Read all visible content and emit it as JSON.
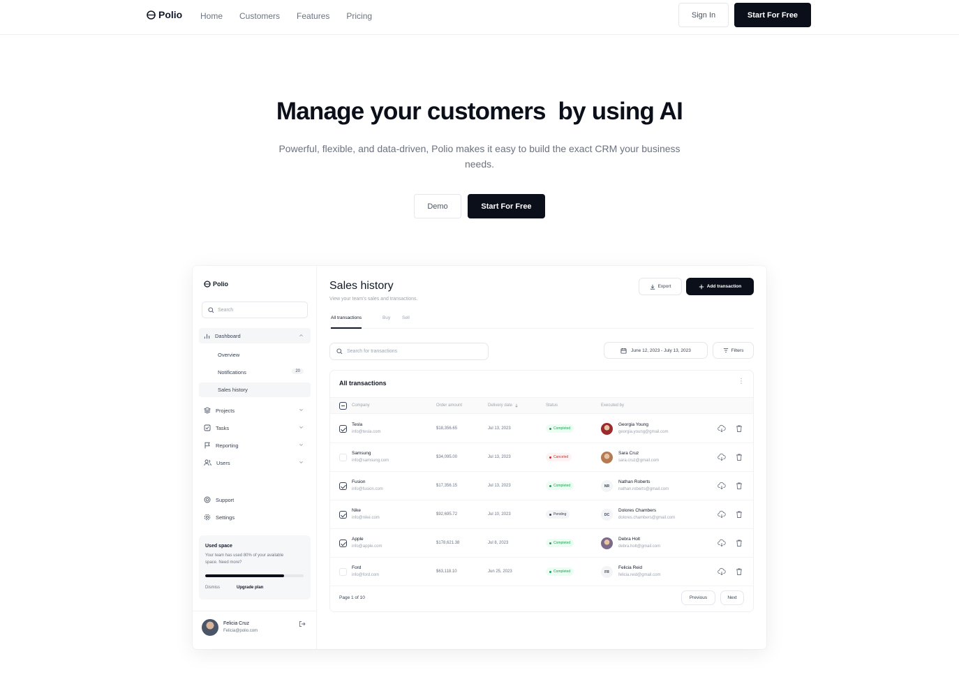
{
  "nav": {
    "brand": "Polio",
    "links": [
      "Home",
      "Customers",
      "Features",
      "Pricing"
    ],
    "sign_in": "Sign In",
    "start_free": "Start For Free"
  },
  "hero": {
    "title": "Manage your customers  by using AI",
    "subtitle": "Powerful, flexible, and data-driven, Polio makes it easy to build the exact CRM your business needs.",
    "demo": "Demo",
    "start_free": "Start For Free"
  },
  "app": {
    "sidebar": {
      "brand": "Polio",
      "search_placeholder": "Search",
      "dashboard": "Dashboard",
      "sub_items": [
        "Overview",
        "Notifications",
        "Sales history"
      ],
      "notifications_count": "20",
      "items": [
        "Projects",
        "Tasks",
        "Reporting",
        "Users"
      ],
      "support": "Support",
      "settings": "Settings",
      "used_space": {
        "title": "Used space",
        "description": "Your team has used 80% of your available space. Need more?",
        "percent": 0.8,
        "dismiss": "Dismiss",
        "upgrade": "Upgrade plan"
      },
      "user": {
        "name": "Felicia Cruz",
        "email": "Felicia@polio.com"
      }
    },
    "main": {
      "title": "Sales history",
      "subtitle": "View your team's sales and transactions.",
      "export": "Export",
      "add_transaction": "Add transaction",
      "tabs": [
        "All transactions",
        "Buy",
        "Sell"
      ],
      "search_placeholder": "Search for transactions",
      "date_range": "June 12, 2023 - July 13, 2023",
      "filters": "Filters",
      "card_title": "All transactions",
      "columns": [
        "Company",
        "Order amount",
        "Delivery date",
        "Status",
        "Executed by"
      ],
      "rows": [
        {
          "checked": true,
          "company": "Tesla",
          "email": "info@tesla.com",
          "amount": "$18,356.65",
          "date": "Jul 13, 2023",
          "status": "Completed",
          "status_type": "completed",
          "person": "Georgia Young",
          "person_email": "georgia.young@gmail.com",
          "avatar": "",
          "avatar_color": "#9b2c2c"
        },
        {
          "checked": false,
          "company": "Samsung",
          "email": "info@samsung.com",
          "amount": "$34,095.00",
          "date": "Jul 13, 2023",
          "status": "Canceled",
          "status_type": "canceled",
          "person": "Sara Cruz",
          "person_email": "sara.cruz@gmail.com",
          "avatar": "",
          "avatar_color": "#b7794f"
        },
        {
          "checked": true,
          "company": "Fusion",
          "email": "info@fusion.com",
          "amount": "$17,356.15",
          "date": "Jul 13, 2023",
          "status": "Completed",
          "status_type": "completed",
          "person": "Nathan Roberts",
          "person_email": "nathan.roberts@gmail.com",
          "avatar": "NR",
          "avatar_color": "#f3f4f6"
        },
        {
          "checked": true,
          "company": "Nike",
          "email": "info@nike.com",
          "amount": "$92,695.72",
          "date": "Jul 10, 2023",
          "status": "Pending",
          "status_type": "pending",
          "person": "Dolores Chambers",
          "person_email": "dolores.chambers@gmail.com",
          "avatar": "DC",
          "avatar_color": "#f3f4f6"
        },
        {
          "checked": true,
          "company": "Apple",
          "email": "info@apple.com",
          "amount": "$178,621.38",
          "date": "Jul 8, 2023",
          "status": "Completed",
          "status_type": "completed",
          "person": "Debra Holt",
          "person_email": "debra.holt@gmail.com",
          "avatar": "",
          "avatar_color": "#7c6a8a"
        },
        {
          "checked": false,
          "company": "Ford",
          "email": "info@ford.com",
          "amount": "$63,118.10",
          "date": "Jun 25, 2023",
          "status": "Completed",
          "status_type": "completed",
          "person": "Felicia Reid",
          "person_email": "felicia.reid@gmail.com",
          "avatar": "FR",
          "avatar_color": "#f3f4f6"
        }
      ],
      "pagination": {
        "label": "Page 1 of 10",
        "previous": "Previous",
        "next": "Next"
      }
    }
  }
}
